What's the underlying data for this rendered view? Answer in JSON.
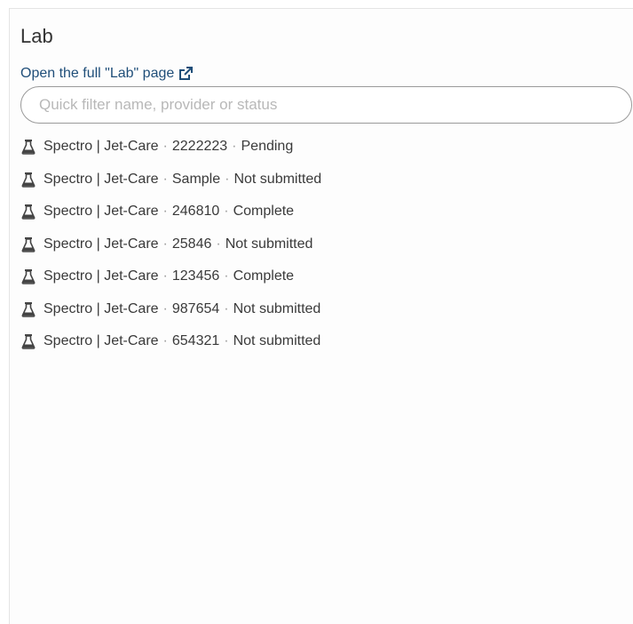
{
  "panel": {
    "title": "Lab",
    "open_link_label": "Open the full \"Lab\" page",
    "search_placeholder": "Quick filter name, provider or status"
  },
  "labs": [
    {
      "name": "Spectro | Jet-Care",
      "id": "2222223",
      "status": "Pending"
    },
    {
      "name": "Spectro | Jet-Care",
      "id": "Sample",
      "status": "Not submitted"
    },
    {
      "name": "Spectro | Jet-Care",
      "id": "246810",
      "status": "Complete"
    },
    {
      "name": "Spectro | Jet-Care",
      "id": "25846",
      "status": "Not submitted"
    },
    {
      "name": "Spectro | Jet-Care",
      "id": "123456",
      "status": "Complete"
    },
    {
      "name": "Spectro | Jet-Care",
      "id": "987654",
      "status": "Not submitted"
    },
    {
      "name": "Spectro | Jet-Care",
      "id": "654321",
      "status": "Not submitted"
    }
  ],
  "separator": "·",
  "icons": {
    "item_icon": "flask-icon",
    "link_icon": "external-link-icon"
  },
  "colors": {
    "link": "#1f4e79",
    "text": "#3a3a3a",
    "border": "#9a9a9a"
  }
}
